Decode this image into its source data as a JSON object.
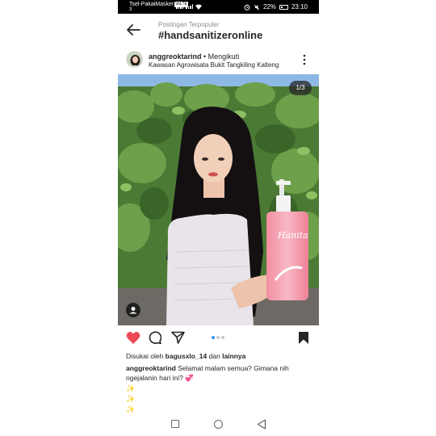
{
  "status_bar": {
    "carrier": "Tsel-PakaiMasker",
    "volte": "VoLTE",
    "carrier_sub": "3",
    "battery": "22%",
    "time": "23:10",
    "icons": [
      "signal-icon",
      "wifi-icon",
      "alarm-icon",
      "mute-icon",
      "battery-icon"
    ]
  },
  "header": {
    "subtitle": "Postingan Terpopuler",
    "title": "#handsanitizeronline",
    "back_icon": "arrow-left-icon"
  },
  "post": {
    "username": "anggreoktarind",
    "follow_status": "Mengikuti",
    "separator": " • ",
    "location": "Kawasan Agrowisata Bukit Tangkiling Kalteng",
    "more_icon": "vertical-dots-icon",
    "image_counter": "1/3",
    "product_brand": "Hanita",
    "carousel_current_index": 1,
    "carousel_total": 3
  },
  "actions": {
    "icons": [
      "heart-icon",
      "comment-icon",
      "share-icon",
      "bookmark-icon"
    ],
    "liked": true,
    "heart_color": "#ed4956"
  },
  "likes": {
    "prefix": "Disukai oleh ",
    "user": "bagusxlo_14",
    "middle": " dan ",
    "others": "lainnya"
  },
  "caption": {
    "username": "anggreoktarind",
    "text": "Selamat malam semua? Gimana nih ngejalanin hari ini? 💞",
    "sparkles": [
      "✨",
      "✨",
      "✨"
    ]
  },
  "nav_bar": {
    "icons": [
      "recent-apps-icon",
      "home-icon",
      "back-triangle-icon"
    ]
  },
  "colors": {
    "accent": "#3897f0",
    "text": "#262626",
    "muted": "#8e8e8e"
  }
}
